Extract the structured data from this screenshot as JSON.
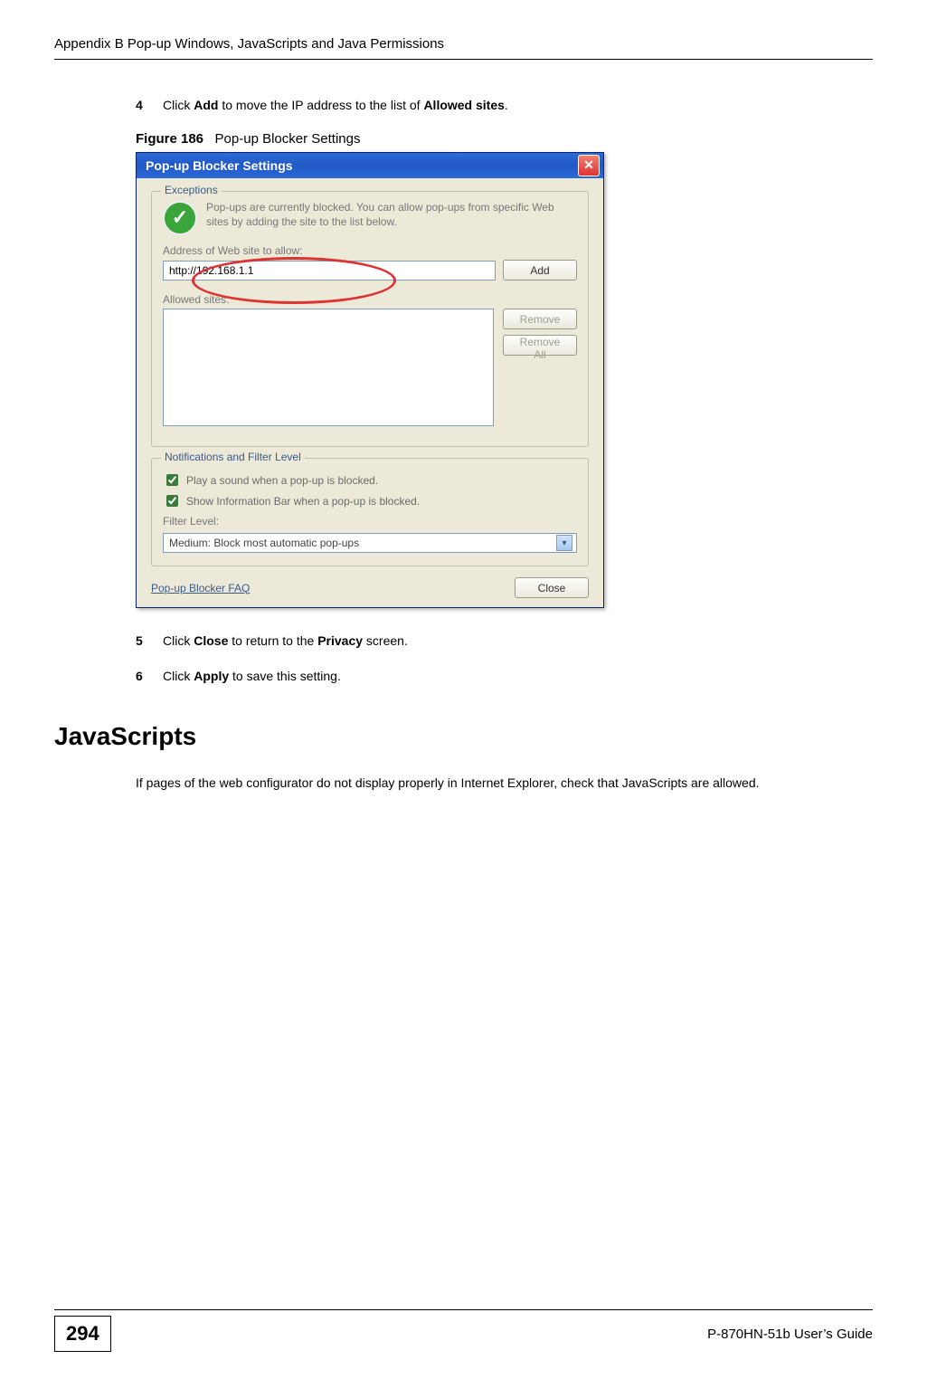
{
  "header": {
    "running_head": "Appendix B Pop-up Windows, JavaScripts and Java Permissions"
  },
  "steps": {
    "s4": {
      "num": "4",
      "pre": "Click ",
      "bold1": "Add",
      "mid": " to move the IP address to the list of ",
      "bold2": "Allowed sites",
      "post": "."
    },
    "s5": {
      "num": "5",
      "pre": "Click ",
      "bold1": "Close",
      "mid": " to return to the ",
      "bold2": "Privacy",
      "post": " screen."
    },
    "s6": {
      "num": "6",
      "pre": "Click ",
      "bold1": "Apply",
      "post": " to save this setting."
    }
  },
  "figure": {
    "label": "Figure 186",
    "caption": "Pop-up Blocker Settings"
  },
  "dialog": {
    "title": "Pop-up Blocker Settings",
    "exceptions_legend": "Exceptions",
    "info_text": "Pop-ups are currently blocked. You can allow pop-ups from specific Web sites by adding the site to the list below.",
    "address_label": "Address of Web site to allow:",
    "address_value": "http://192.168.1.1",
    "add_button": "Add",
    "allowed_label": "Allowed sites:",
    "remove_button": "Remove",
    "remove_all_button": "Remove All",
    "notif_legend": "Notifications and Filter Level",
    "checkbox1": "Play a sound when a pop-up is blocked.",
    "checkbox2": "Show Information Bar when a pop-up is blocked.",
    "filter_label": "Filter Level:",
    "filter_value": "Medium: Block most automatic pop-ups",
    "faq": "Pop-up Blocker FAQ",
    "close_button": "Close"
  },
  "section": {
    "heading": "JavaScripts",
    "para": "If pages of the web configurator do not display properly in Internet Explorer, check that JavaScripts are allowed."
  },
  "footer": {
    "page_number": "294",
    "guide": "P-870HN-51b User’s Guide"
  }
}
